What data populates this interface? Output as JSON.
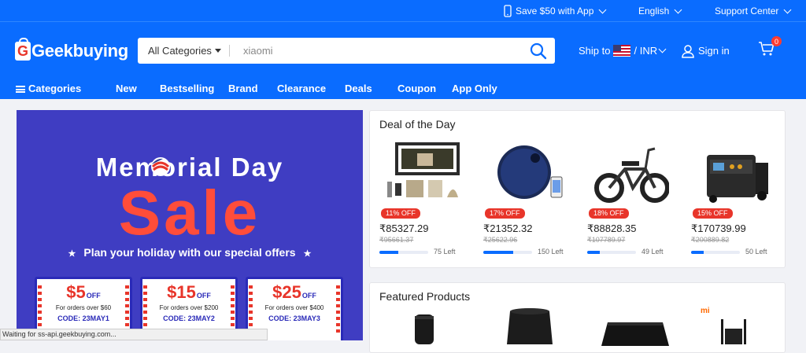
{
  "topbar": {
    "app_promo": "Save $50 with App",
    "language": "English",
    "support": "Support Center"
  },
  "header": {
    "logo_text": "Geekbuying",
    "logo_letter": "G",
    "category_select": "All Categories",
    "search_placeholder": "xiaomi",
    "ship_to_label": "Ship to",
    "currency": "/ INR",
    "sign_in": "Sign in",
    "cart_count": "0"
  },
  "nav": {
    "categories": "Categories",
    "items": [
      "New",
      "Bestselling",
      "Brand",
      "Clearance",
      "Deals",
      "Coupon",
      "App Only"
    ]
  },
  "banner": {
    "title": "Memorial Day",
    "sale": "Sale",
    "subtitle": "Plan your holiday with our special offers",
    "coupons": [
      {
        "amount": "$5",
        "off": "OFF",
        "condition": "For orders over $60",
        "code": "CODE: 23MAY1"
      },
      {
        "amount": "$15",
        "off": "OFF",
        "condition": "For orders over $200",
        "code": "CODE: 23MAY2"
      },
      {
        "amount": "$25",
        "off": "OFF",
        "condition": "For orders over $400",
        "code": "CODE: 23MAY3"
      }
    ]
  },
  "deal_of_the_day": {
    "title": "Deal of the Day",
    "products": [
      {
        "name": "laser-engraver",
        "discount": "11% OFF",
        "price": "₹85327.29",
        "old_price": "₹95661.37",
        "stock_left": "75 Left",
        "progress": 0.38
      },
      {
        "name": "robot-vacuum",
        "discount": "17% OFF",
        "price": "₹21352.32",
        "old_price": "₹25622.96",
        "stock_left": "150 Left",
        "progress": 0.62
      },
      {
        "name": "electric-bike",
        "discount": "18% OFF",
        "price": "₹88828.35",
        "old_price": "₹107789.97",
        "stock_left": "49 Left",
        "progress": 0.25
      },
      {
        "name": "power-station",
        "discount": "15% OFF",
        "price": "₹170739.99",
        "old_price": "₹200889.82",
        "stock_left": "50 Left",
        "progress": 0.26
      }
    ]
  },
  "featured": {
    "title": "Featured Products",
    "brand_mark": "mi"
  },
  "statusbar": {
    "text": "Waiting for ss-api.geekbuying.com..."
  },
  "colors": {
    "brand_blue": "#0a6cff",
    "banner_blue": "#3f3dc2",
    "sale_red": "#ff4d3a",
    "badge_red": "#e8352a"
  }
}
